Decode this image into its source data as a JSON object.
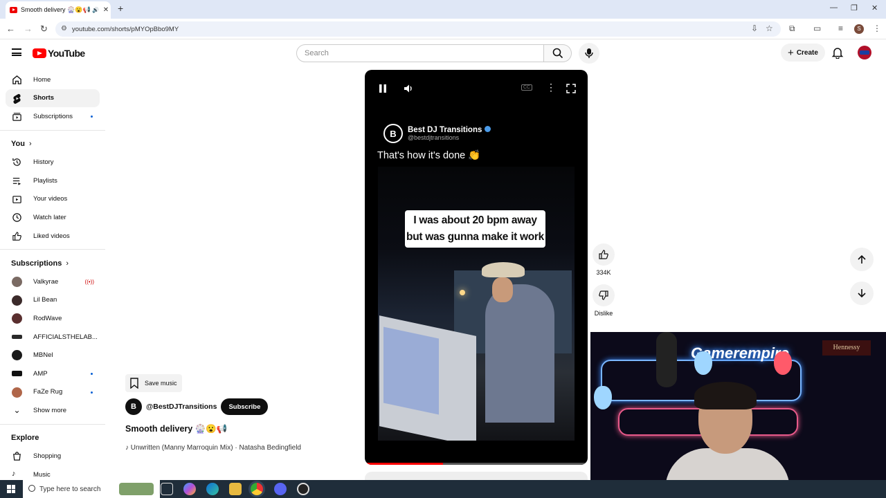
{
  "browser": {
    "tab_title": "Smooth delivery 🎡😮📢",
    "tab_close": "✕",
    "new_tab": "+",
    "url": "youtube.com/shorts/pMYOpBbo9MY",
    "profile_initial": "S"
  },
  "masthead": {
    "logo_text": "YouTube",
    "search_placeholder": "Search",
    "create_label": "Create"
  },
  "sidebar": {
    "main": [
      {
        "label": "Home",
        "icon": "home-icon"
      },
      {
        "label": "Shorts",
        "icon": "shorts-icon",
        "active": true
      },
      {
        "label": "Subscriptions",
        "icon": "subscriptions-icon",
        "dot": true
      }
    ],
    "you_header": "You",
    "you": [
      {
        "label": "History",
        "icon": "history-icon"
      },
      {
        "label": "Playlists",
        "icon": "playlists-icon"
      },
      {
        "label": "Your videos",
        "icon": "your-videos-icon"
      },
      {
        "label": "Watch later",
        "icon": "watch-later-icon"
      },
      {
        "label": "Liked videos",
        "icon": "liked-videos-icon"
      }
    ],
    "subscriptions_header": "Subscriptions",
    "subscriptions": [
      {
        "label": "Valkyrae",
        "live": true,
        "color": "#7a6a63"
      },
      {
        "label": "Lil Bean",
        "color": "#3b2a2a"
      },
      {
        "label": "RodWave",
        "color": "#5a2f2f"
      },
      {
        "label": "AFFICIALSTHELAB...",
        "color": "#2a2a2a"
      },
      {
        "label": "MBNel",
        "color": "#1a1a1a"
      },
      {
        "label": "AMP",
        "dot": true,
        "color": "#111111"
      },
      {
        "label": "FaZe Rug",
        "dot": true,
        "color": "#b0664a"
      }
    ],
    "show_more": "Show more",
    "explore_header": "Explore",
    "explore": [
      {
        "label": "Shopping",
        "icon": "shopping-icon"
      },
      {
        "label": "Music",
        "icon": "music-icon"
      }
    ]
  },
  "video": {
    "channel_display": "Best DJ Transitions",
    "channel_handle": "@bestdjtransitions",
    "channel_initial": "B",
    "caption": "That's how it's done 👏",
    "bubble_line1": "I was about 20 bpm away",
    "bubble_line2": "but was gunna make it work",
    "cc_label": "CC",
    "progress_fraction": 0.35
  },
  "actions": {
    "like_count": "334K",
    "dislike_label": "Dislike"
  },
  "info": {
    "save_music": "Save music",
    "channel_name": "@BestDJTransitions",
    "subscribe": "Subscribe",
    "title": "Smooth delivery 🎡😮📢",
    "music": "Unwritten (Manny Marroquin Mix) · Natasha Bedingfield"
  },
  "webcam": {
    "neon_sign": "Gamerempire",
    "bottle_label": "Hennessy"
  },
  "taskbar": {
    "search_placeholder": "Type here to search"
  }
}
